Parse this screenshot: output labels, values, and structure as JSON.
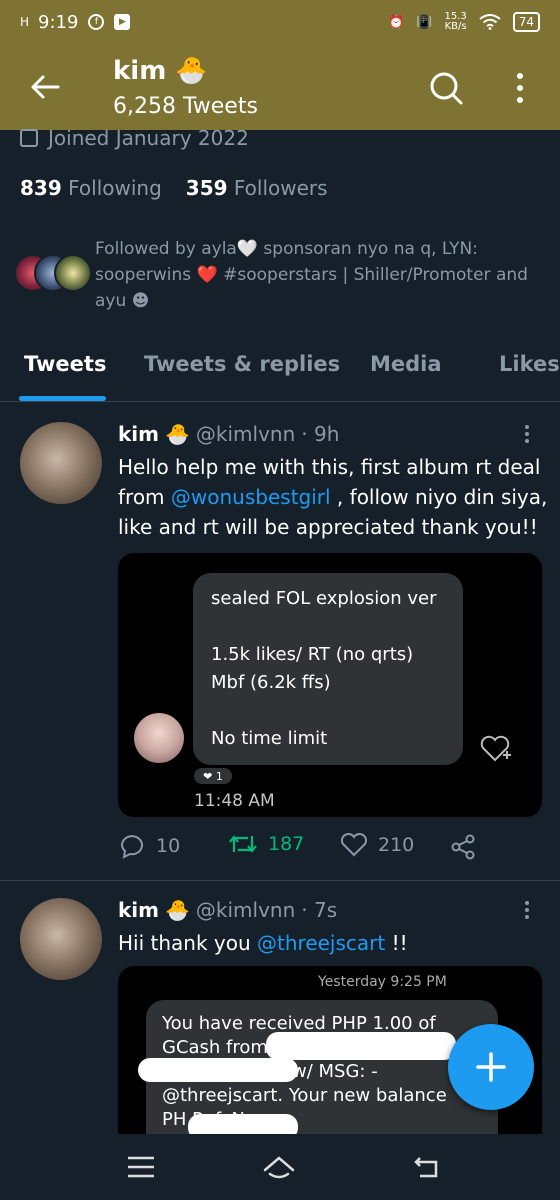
{
  "status_bar": {
    "time": "9:19",
    "signal": "H",
    "speed_value": "15.3",
    "speed_unit": "KB/s",
    "battery": "74"
  },
  "header": {
    "name": "kim",
    "emoji": "🐣",
    "tweet_count": "6,258 Tweets"
  },
  "profile": {
    "joined": "Joined January 2022",
    "following_count": "839",
    "following_label": "Following",
    "followers_count": "359",
    "followers_label": "Followers",
    "followed_by": "Followed by ayla🤍 sponsoran nyo na q, LYN: sooperwins ❤️ #sooperstars | Shiller/Promoter and ayu ☻"
  },
  "tabs": [
    "Tweets",
    "Tweets & replies",
    "Media",
    "Likes"
  ],
  "tweets": [
    {
      "name": "kim",
      "emoji": "🐣",
      "handle": "@kimlvnn",
      "time": "· 9h",
      "text_before": "Hello help me with this, first album rt deal from ",
      "mention": "@wonusbestgirl",
      "text_after": " , follow niyo din siya, like and rt will be appreciated thank you!!",
      "media": {
        "lines": [
          "sealed FOL explosion ver",
          "",
          "1.5k likes/ RT (no qrts)",
          "Mbf (6.2k ffs)",
          "",
          "No time limit"
        ],
        "reaction": "❤ 1",
        "time": "11:48 AM"
      },
      "replies": "10",
      "retweets": "187",
      "likes": "210"
    },
    {
      "name": "kim",
      "emoji": "🐣",
      "handle": "@kimlvnn",
      "time": "· 7s",
      "text_before": "Hii thank you ",
      "mention": "@threejscart",
      "text_after": " !!",
      "media": {
        "time": "Yesterday 9:25 PM",
        "lines": [
          "You have received PHP 1.00 of",
          "GCash from",
          "w/ MSG: -",
          "@threejscart. Your new balance",
          "PH Ref. No."
        ]
      }
    }
  ],
  "colors": {
    "header_bg": "#7e7333",
    "bg": "#15202b",
    "accent": "#1d9bf0",
    "retweet": "#00ba7c",
    "muted": "#8b98a5"
  }
}
